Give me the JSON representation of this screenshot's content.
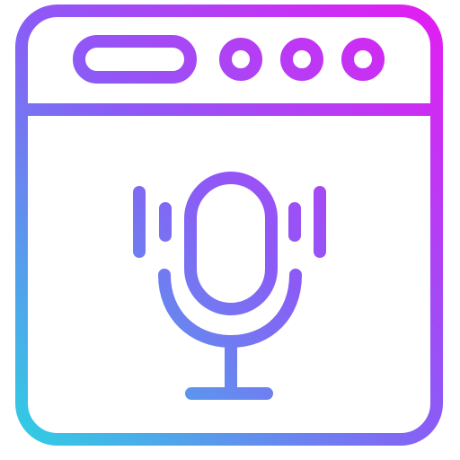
{
  "icon": {
    "name": "browser-voice-recording-icon",
    "gradient_start": "#2ed0e3",
    "gradient_mid": "#8a5cf6",
    "gradient_end": "#e61bf2",
    "parts": [
      "browser-window-frame-icon",
      "address-bar-icon",
      "window-control-dots-icon",
      "microphone-icon",
      "sound-wave-bars-icon"
    ]
  }
}
